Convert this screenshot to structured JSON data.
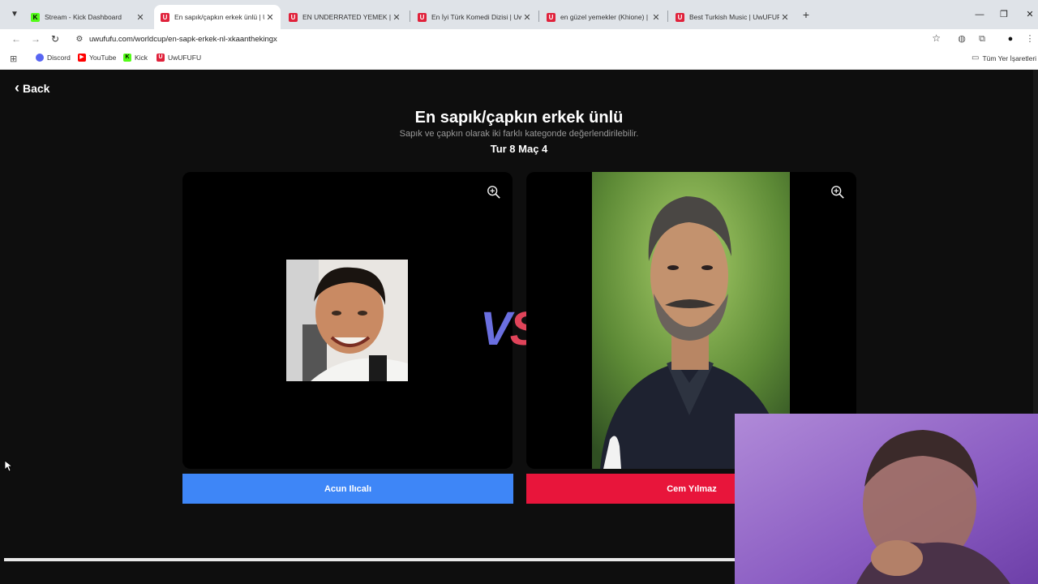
{
  "browser": {
    "tabs": [
      {
        "title": "Stream - Kick Dashboard",
        "favicon": "kick",
        "active": false
      },
      {
        "title": "En sapık/çapkın erkek ünlü | Uw",
        "favicon": "uwufufu",
        "active": true
      },
      {
        "title": "EN UNDERRATED YEMEK | UwU",
        "favicon": "uwufufu",
        "active": false
      },
      {
        "title": "En İyi Türk Komedi Dizisi | UwU",
        "favicon": "uwufufu",
        "active": false
      },
      {
        "title": "en güzel yemekler (Khione) | U",
        "favicon": "uwufufu",
        "active": false
      },
      {
        "title": "Best Turkish Music | UwUFUFU",
        "favicon": "uwufufu",
        "active": false
      }
    ],
    "url": "uwufufu.com/worldcup/en-sapk-erkek-nl-xkaanthekingx",
    "bookmarks": [
      {
        "label": "Discord",
        "color": "#5865f2"
      },
      {
        "label": "YouTube",
        "color": "#ff0000"
      },
      {
        "label": "Kick",
        "color": "#53fc18"
      },
      {
        "label": "UwUFUFU",
        "color": "#e0223b"
      }
    ],
    "all_bookmarks_label": "Tüm Yer İşaretleri"
  },
  "page": {
    "back_label": "Back",
    "title": "En sapık/çapkın erkek ünlü",
    "subtitle": "Sapık ve çapkın olarak iki farklı kategonde değerlendirilebilir.",
    "round_label": "Tur 8 Maç 4",
    "vs_v": "V",
    "vs_s": "S",
    "left_choice": {
      "name": "Acun Ilıcalı",
      "color": "#3e86f7"
    },
    "right_choice": {
      "name": "Cem Yılmaz",
      "color": "#e8153b"
    }
  }
}
